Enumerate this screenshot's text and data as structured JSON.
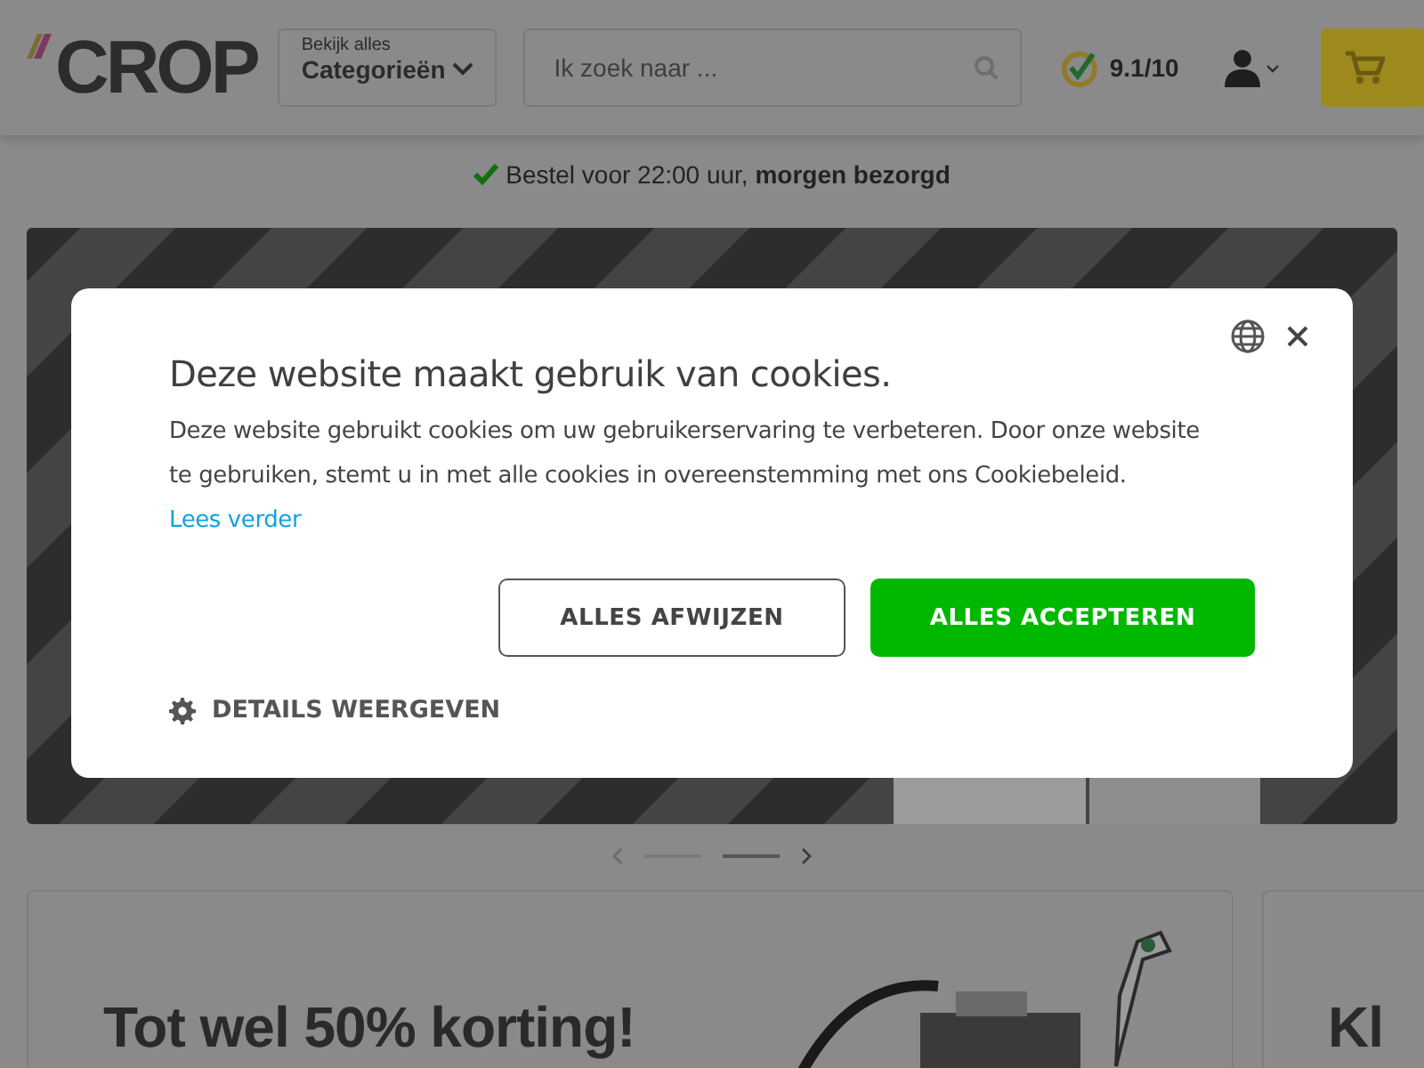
{
  "header": {
    "logo": "CROP",
    "categories": {
      "caption": "Bekijk alles",
      "label": "Categorieën"
    },
    "search": {
      "placeholder": "Ik zoek naar ..."
    },
    "rating": "9.1/10"
  },
  "usp": {
    "text": "Bestel voor 22:00 uur, **morgen bezorgd**"
  },
  "carousel": {
    "dashes": [
      {
        "selected": false
      },
      {
        "selected": true
      }
    ]
  },
  "promo_cards": [
    {
      "headline": "Tot wel 50% korting!"
    },
    {
      "headline": "Kl"
    }
  ],
  "cookie_dialog": {
    "title": "Deze website maakt gebruik van cookies.",
    "body": "Deze website gebruikt cookies om uw gebruikerservaring te verbeteren. Door onze website te gebruiken, stemt u in met alle cookies in overeenstemming met ons Cookiebeleid.",
    "link": "Lees verder",
    "buttons": [
      {
        "label": "ALLES AFWIJZEN",
        "kind": "outline"
      },
      {
        "label": "ALLES ACCEPTEREN",
        "kind": "primary"
      }
    ],
    "details": "DETAILS WEERGEVEN"
  }
}
